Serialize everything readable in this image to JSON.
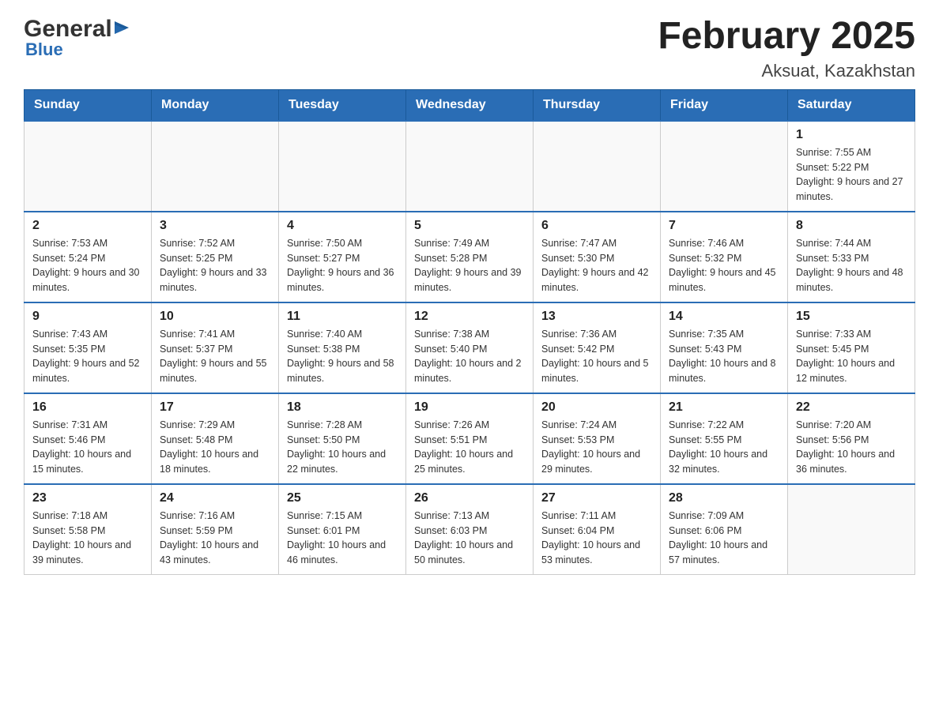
{
  "header": {
    "logo_general": "General",
    "logo_blue": "Blue",
    "month_title": "February 2025",
    "location": "Aksuat, Kazakhstan"
  },
  "weekdays": [
    "Sunday",
    "Monday",
    "Tuesday",
    "Wednesday",
    "Thursday",
    "Friday",
    "Saturday"
  ],
  "weeks": [
    [
      {
        "day": "",
        "sunrise": "",
        "sunset": "",
        "daylight": ""
      },
      {
        "day": "",
        "sunrise": "",
        "sunset": "",
        "daylight": ""
      },
      {
        "day": "",
        "sunrise": "",
        "sunset": "",
        "daylight": ""
      },
      {
        "day": "",
        "sunrise": "",
        "sunset": "",
        "daylight": ""
      },
      {
        "day": "",
        "sunrise": "",
        "sunset": "",
        "daylight": ""
      },
      {
        "day": "",
        "sunrise": "",
        "sunset": "",
        "daylight": ""
      },
      {
        "day": "1",
        "sunrise": "Sunrise: 7:55 AM",
        "sunset": "Sunset: 5:22 PM",
        "daylight": "Daylight: 9 hours and 27 minutes."
      }
    ],
    [
      {
        "day": "2",
        "sunrise": "Sunrise: 7:53 AM",
        "sunset": "Sunset: 5:24 PM",
        "daylight": "Daylight: 9 hours and 30 minutes."
      },
      {
        "day": "3",
        "sunrise": "Sunrise: 7:52 AM",
        "sunset": "Sunset: 5:25 PM",
        "daylight": "Daylight: 9 hours and 33 minutes."
      },
      {
        "day": "4",
        "sunrise": "Sunrise: 7:50 AM",
        "sunset": "Sunset: 5:27 PM",
        "daylight": "Daylight: 9 hours and 36 minutes."
      },
      {
        "day": "5",
        "sunrise": "Sunrise: 7:49 AM",
        "sunset": "Sunset: 5:28 PM",
        "daylight": "Daylight: 9 hours and 39 minutes."
      },
      {
        "day": "6",
        "sunrise": "Sunrise: 7:47 AM",
        "sunset": "Sunset: 5:30 PM",
        "daylight": "Daylight: 9 hours and 42 minutes."
      },
      {
        "day": "7",
        "sunrise": "Sunrise: 7:46 AM",
        "sunset": "Sunset: 5:32 PM",
        "daylight": "Daylight: 9 hours and 45 minutes."
      },
      {
        "day": "8",
        "sunrise": "Sunrise: 7:44 AM",
        "sunset": "Sunset: 5:33 PM",
        "daylight": "Daylight: 9 hours and 48 minutes."
      }
    ],
    [
      {
        "day": "9",
        "sunrise": "Sunrise: 7:43 AM",
        "sunset": "Sunset: 5:35 PM",
        "daylight": "Daylight: 9 hours and 52 minutes."
      },
      {
        "day": "10",
        "sunrise": "Sunrise: 7:41 AM",
        "sunset": "Sunset: 5:37 PM",
        "daylight": "Daylight: 9 hours and 55 minutes."
      },
      {
        "day": "11",
        "sunrise": "Sunrise: 7:40 AM",
        "sunset": "Sunset: 5:38 PM",
        "daylight": "Daylight: 9 hours and 58 minutes."
      },
      {
        "day": "12",
        "sunrise": "Sunrise: 7:38 AM",
        "sunset": "Sunset: 5:40 PM",
        "daylight": "Daylight: 10 hours and 2 minutes."
      },
      {
        "day": "13",
        "sunrise": "Sunrise: 7:36 AM",
        "sunset": "Sunset: 5:42 PM",
        "daylight": "Daylight: 10 hours and 5 minutes."
      },
      {
        "day": "14",
        "sunrise": "Sunrise: 7:35 AM",
        "sunset": "Sunset: 5:43 PM",
        "daylight": "Daylight: 10 hours and 8 minutes."
      },
      {
        "day": "15",
        "sunrise": "Sunrise: 7:33 AM",
        "sunset": "Sunset: 5:45 PM",
        "daylight": "Daylight: 10 hours and 12 minutes."
      }
    ],
    [
      {
        "day": "16",
        "sunrise": "Sunrise: 7:31 AM",
        "sunset": "Sunset: 5:46 PM",
        "daylight": "Daylight: 10 hours and 15 minutes."
      },
      {
        "day": "17",
        "sunrise": "Sunrise: 7:29 AM",
        "sunset": "Sunset: 5:48 PM",
        "daylight": "Daylight: 10 hours and 18 minutes."
      },
      {
        "day": "18",
        "sunrise": "Sunrise: 7:28 AM",
        "sunset": "Sunset: 5:50 PM",
        "daylight": "Daylight: 10 hours and 22 minutes."
      },
      {
        "day": "19",
        "sunrise": "Sunrise: 7:26 AM",
        "sunset": "Sunset: 5:51 PM",
        "daylight": "Daylight: 10 hours and 25 minutes."
      },
      {
        "day": "20",
        "sunrise": "Sunrise: 7:24 AM",
        "sunset": "Sunset: 5:53 PM",
        "daylight": "Daylight: 10 hours and 29 minutes."
      },
      {
        "day": "21",
        "sunrise": "Sunrise: 7:22 AM",
        "sunset": "Sunset: 5:55 PM",
        "daylight": "Daylight: 10 hours and 32 minutes."
      },
      {
        "day": "22",
        "sunrise": "Sunrise: 7:20 AM",
        "sunset": "Sunset: 5:56 PM",
        "daylight": "Daylight: 10 hours and 36 minutes."
      }
    ],
    [
      {
        "day": "23",
        "sunrise": "Sunrise: 7:18 AM",
        "sunset": "Sunset: 5:58 PM",
        "daylight": "Daylight: 10 hours and 39 minutes."
      },
      {
        "day": "24",
        "sunrise": "Sunrise: 7:16 AM",
        "sunset": "Sunset: 5:59 PM",
        "daylight": "Daylight: 10 hours and 43 minutes."
      },
      {
        "day": "25",
        "sunrise": "Sunrise: 7:15 AM",
        "sunset": "Sunset: 6:01 PM",
        "daylight": "Daylight: 10 hours and 46 minutes."
      },
      {
        "day": "26",
        "sunrise": "Sunrise: 7:13 AM",
        "sunset": "Sunset: 6:03 PM",
        "daylight": "Daylight: 10 hours and 50 minutes."
      },
      {
        "day": "27",
        "sunrise": "Sunrise: 7:11 AM",
        "sunset": "Sunset: 6:04 PM",
        "daylight": "Daylight: 10 hours and 53 minutes."
      },
      {
        "day": "28",
        "sunrise": "Sunrise: 7:09 AM",
        "sunset": "Sunset: 6:06 PM",
        "daylight": "Daylight: 10 hours and 57 minutes."
      },
      {
        "day": "",
        "sunrise": "",
        "sunset": "",
        "daylight": ""
      }
    ]
  ]
}
